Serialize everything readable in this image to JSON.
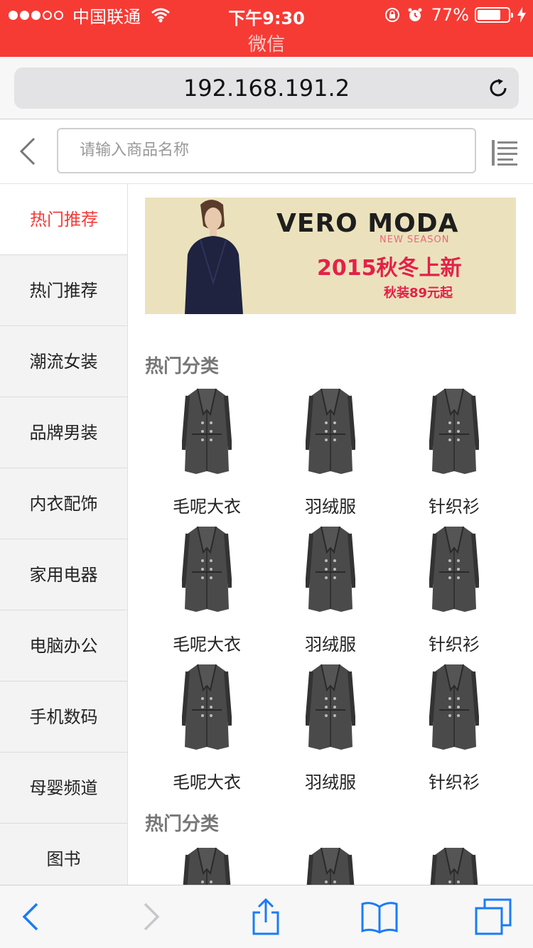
{
  "status_bar": {
    "carrier": "中国联通",
    "time": "下午9:30",
    "battery": "77%",
    "battery_level": 0.77,
    "app_name": "微信"
  },
  "browser": {
    "url": "192.168.191.2"
  },
  "search": {
    "placeholder": "请输入商品名称"
  },
  "sidebar": {
    "items": [
      {
        "label": "热门推荐",
        "active": true
      },
      {
        "label": "热门推荐",
        "active": false
      },
      {
        "label": "潮流女装",
        "active": false
      },
      {
        "label": "品牌男装",
        "active": false
      },
      {
        "label": "内衣配饰",
        "active": false
      },
      {
        "label": "家用电器",
        "active": false
      },
      {
        "label": "电脑办公",
        "active": false
      },
      {
        "label": "手机数码",
        "active": false
      },
      {
        "label": "母婴频道",
        "active": false
      },
      {
        "label": "图书",
        "active": false
      }
    ]
  },
  "banner": {
    "brand": "VERO MODA",
    "season": "NEW SEASON",
    "title": "2015秋冬上新",
    "subtitle": "秋装89元起"
  },
  "sections": [
    {
      "title": "热门分类",
      "items": [
        "毛呢大衣",
        "羽绒服",
        "针织衫",
        "毛呢大衣",
        "羽绒服",
        "针织衫",
        "毛呢大衣",
        "羽绒服",
        "针织衫"
      ]
    },
    {
      "title": "热门分类",
      "items": []
    }
  ],
  "colors": {
    "accent": "#f63b35",
    "active_text": "#f23c38",
    "ios_blue": "#1a7cf6"
  }
}
